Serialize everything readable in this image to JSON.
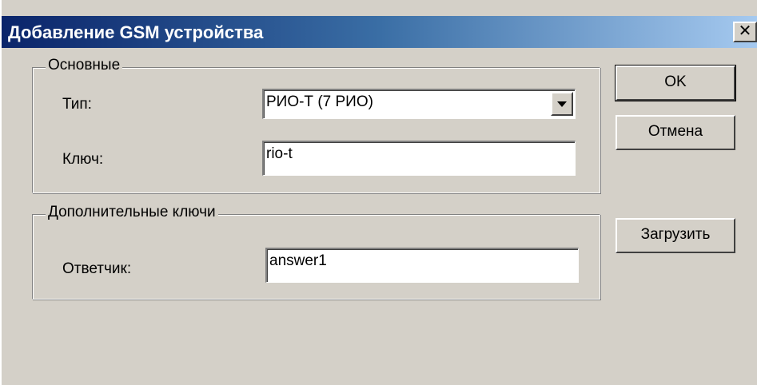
{
  "window": {
    "title": "Добавление GSM устройства",
    "close_glyph": "✕"
  },
  "main_group": {
    "title": "Основные",
    "type_label": "Тип:",
    "type_value": "РИО-Т (7 РИО)",
    "key_label": "Ключ:",
    "key_value": "rio-t"
  },
  "extra_group": {
    "title": "Дополнительные ключи",
    "responder_label": "Ответчик:",
    "responder_value": "answer1"
  },
  "buttons": {
    "ok": "OK",
    "cancel": "Отмена",
    "load": "Загрузить"
  }
}
